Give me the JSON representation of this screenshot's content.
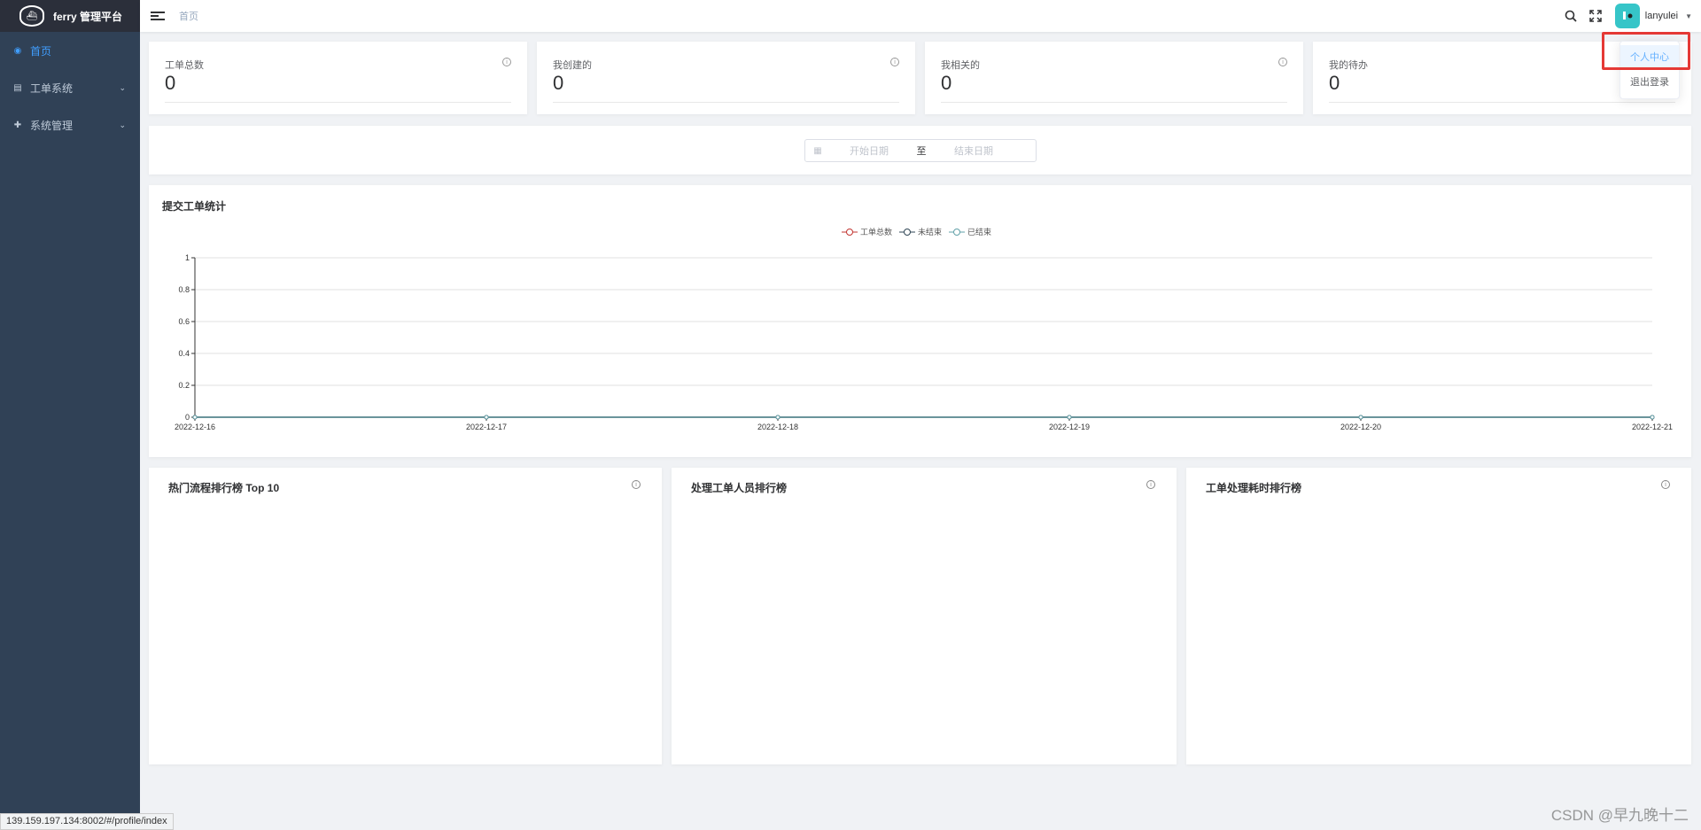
{
  "app": {
    "title": "ferry 管理平台",
    "logo_icon": "ferry-logo-icon"
  },
  "sidebar": {
    "items": [
      {
        "label": "首页",
        "icon": "dashboard-icon",
        "active": true
      },
      {
        "label": "工单系统",
        "icon": "ticket-icon",
        "active": false
      },
      {
        "label": "系统管理",
        "icon": "settings-icon",
        "active": false
      }
    ]
  },
  "navbar": {
    "breadcrumb": "首页",
    "username": "lanyulei"
  },
  "dropdown": {
    "items": [
      "个人中心",
      "退出登录"
    ]
  },
  "stats": [
    {
      "label": "工单总数",
      "value": "0"
    },
    {
      "label": "我创建的",
      "value": "0"
    },
    {
      "label": "我相关的",
      "value": "0"
    },
    {
      "label": "我的待办",
      "value": "0"
    }
  ],
  "date_range": {
    "start_placeholder": "开始日期",
    "separator": "至",
    "end_placeholder": "结束日期"
  },
  "chart_data": {
    "type": "line",
    "title": "提交工单统计",
    "categories": [
      "2022-12-16",
      "2022-12-17",
      "2022-12-18",
      "2022-12-19",
      "2022-12-20",
      "2022-12-21"
    ],
    "series": [
      {
        "name": "工单总数",
        "values": [
          0,
          0,
          0,
          0,
          0,
          0
        ],
        "color": "#c23531"
      },
      {
        "name": "未结束",
        "values": [
          0,
          0,
          0,
          0,
          0,
          0
        ],
        "color": "#2f4554"
      },
      {
        "name": "已结束",
        "values": [
          0,
          0,
          0,
          0,
          0,
          0
        ],
        "color": "#61a0a8"
      }
    ],
    "ylim": [
      0,
      1
    ],
    "yticks": [
      "0",
      "0.2",
      "0.4",
      "0.6",
      "0.8",
      "1"
    ],
    "grid": true,
    "legend": "top-center"
  },
  "rankings": [
    {
      "title": "热门流程排行榜 Top 10"
    },
    {
      "title": "处理工单人员排行榜"
    },
    {
      "title": "工单处理耗时排行榜"
    }
  ],
  "status_url": "139.159.197.134:8002/#/profile/index",
  "watermark": "CSDN @早九晚十二",
  "colors": {
    "sidebar": "#304156",
    "accent": "#409eff",
    "highlight": "#e53935"
  }
}
